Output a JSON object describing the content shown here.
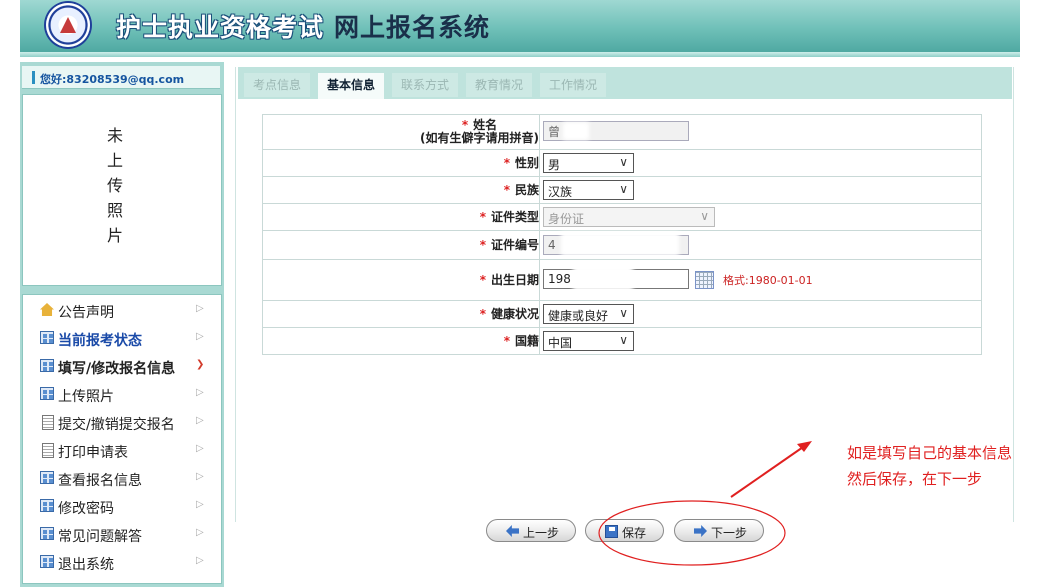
{
  "header": {
    "title_main": "护士执业资格考试",
    "title_sub": "网上报名系统"
  },
  "user": {
    "greeting": "您好:83208539@qq.com"
  },
  "photo": {
    "placeholder_chars": [
      "未",
      "上",
      "传",
      "照",
      "片"
    ]
  },
  "menu": [
    {
      "label": "公告声明",
      "icon": "home-icon"
    },
    {
      "label": "当前报考状态",
      "icon": "window-icon"
    },
    {
      "label": "填写/修改报名信息",
      "icon": "window-icon"
    },
    {
      "label": "上传照片",
      "icon": "window-icon"
    },
    {
      "label": "提交/撤销提交报名",
      "icon": "document-icon"
    },
    {
      "label": "打印申请表",
      "icon": "document-icon"
    },
    {
      "label": "查看报名信息",
      "icon": "window-icon"
    },
    {
      "label": "修改密码",
      "icon": "window-icon"
    },
    {
      "label": "常见问题解答",
      "icon": "window-icon"
    },
    {
      "label": "退出系统",
      "icon": "window-icon"
    }
  ],
  "tabs": [
    {
      "label": "考点信息",
      "active": false
    },
    {
      "label": "基本信息",
      "active": true
    },
    {
      "label": "联系方式",
      "active": false
    },
    {
      "label": "教育情况",
      "active": false
    },
    {
      "label": "工作情况",
      "active": false
    }
  ],
  "form": {
    "name_label": "姓名",
    "name_hint": "(如有生僻字请用拼音)",
    "name_value": "曾",
    "gender_label": "性别",
    "gender_value": "男",
    "ethnicity_label": "民族",
    "ethnicity_value": "汉族",
    "id_type_label": "证件类型",
    "id_type_value": "身份证",
    "id_number_label": "证件编号",
    "id_number_value": "4",
    "birthdate_label": "出生日期",
    "birthdate_value": "198",
    "birthdate_format": "格式:1980-01-01",
    "health_label": "健康状况",
    "health_value": "健康或良好",
    "nationality_label": "国籍",
    "nationality_value": "中国"
  },
  "buttons": {
    "prev": "上一步",
    "save": "保存",
    "next": "下一步"
  },
  "annotation": {
    "line1": "如是填写自己的基本信息",
    "line2": "然后保存，在下一步",
    "color": "#e02020"
  }
}
